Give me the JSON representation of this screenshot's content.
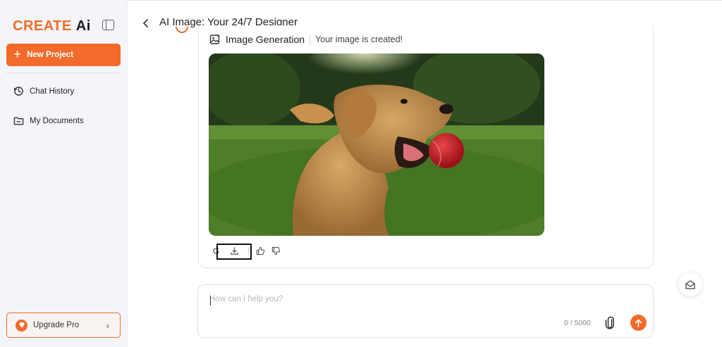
{
  "sidebar": {
    "logo_brand": "CREATE",
    "logo_suffix": "Ai",
    "new_project_label": "New Project",
    "items": [
      {
        "label": "Chat History",
        "icon": "history-icon"
      },
      {
        "label": "My Documents",
        "icon": "folder-icon"
      }
    ],
    "upgrade_label": "Upgrade Pro"
  },
  "header": {
    "title": "AI Image: Your 24/7 Designer"
  },
  "message": {
    "tool_label": "Image Generation",
    "status": "Your image is created!",
    "image_icon": "golden-retriever-with-red-ball-photo"
  },
  "composer": {
    "placeholder": "How can I help you?",
    "counter": "0 / 5000"
  },
  "colors": {
    "accent": "#f26b2a",
    "sidebar_bg": "#f4f5f9"
  }
}
